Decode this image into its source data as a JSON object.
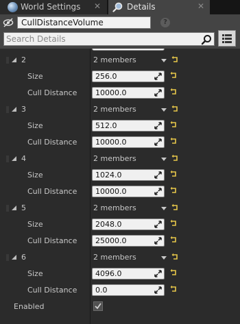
{
  "tabs": [
    {
      "label": "World Settings",
      "close": "✕",
      "icon": "globe-icon"
    },
    {
      "label": "Details",
      "close": "✕",
      "icon": "magnifier-icon"
    }
  ],
  "header": {
    "actor_name": "CullDistanceVolume",
    "help": "?",
    "search_placeholder": "Search Details"
  },
  "properties": {
    "groups": [
      {
        "index": "2",
        "members": "2 members",
        "size_label": "Size",
        "size": "256.0",
        "cull_label": "Cull Distance",
        "cull": "10000.0"
      },
      {
        "index": "3",
        "members": "2 members",
        "size_label": "Size",
        "size": "512.0",
        "cull_label": "Cull Distance",
        "cull": "10000.0"
      },
      {
        "index": "4",
        "members": "2 members",
        "size_label": "Size",
        "size": "1024.0",
        "cull_label": "Cull Distance",
        "cull": "10000.0"
      },
      {
        "index": "5",
        "members": "2 members",
        "size_label": "Size",
        "size": "2048.0",
        "cull_label": "Cull Distance",
        "cull": "25000.0"
      },
      {
        "index": "6",
        "members": "2 members",
        "size_label": "Size",
        "size": "4096.0",
        "cull_label": "Cull Distance",
        "cull": "0.0"
      }
    ],
    "enabled_label": "Enabled",
    "enabled_checked": true
  },
  "colors": {
    "panel": "#2b2b2b",
    "header": "#444444",
    "reset_arrow": "#e8c84a"
  }
}
